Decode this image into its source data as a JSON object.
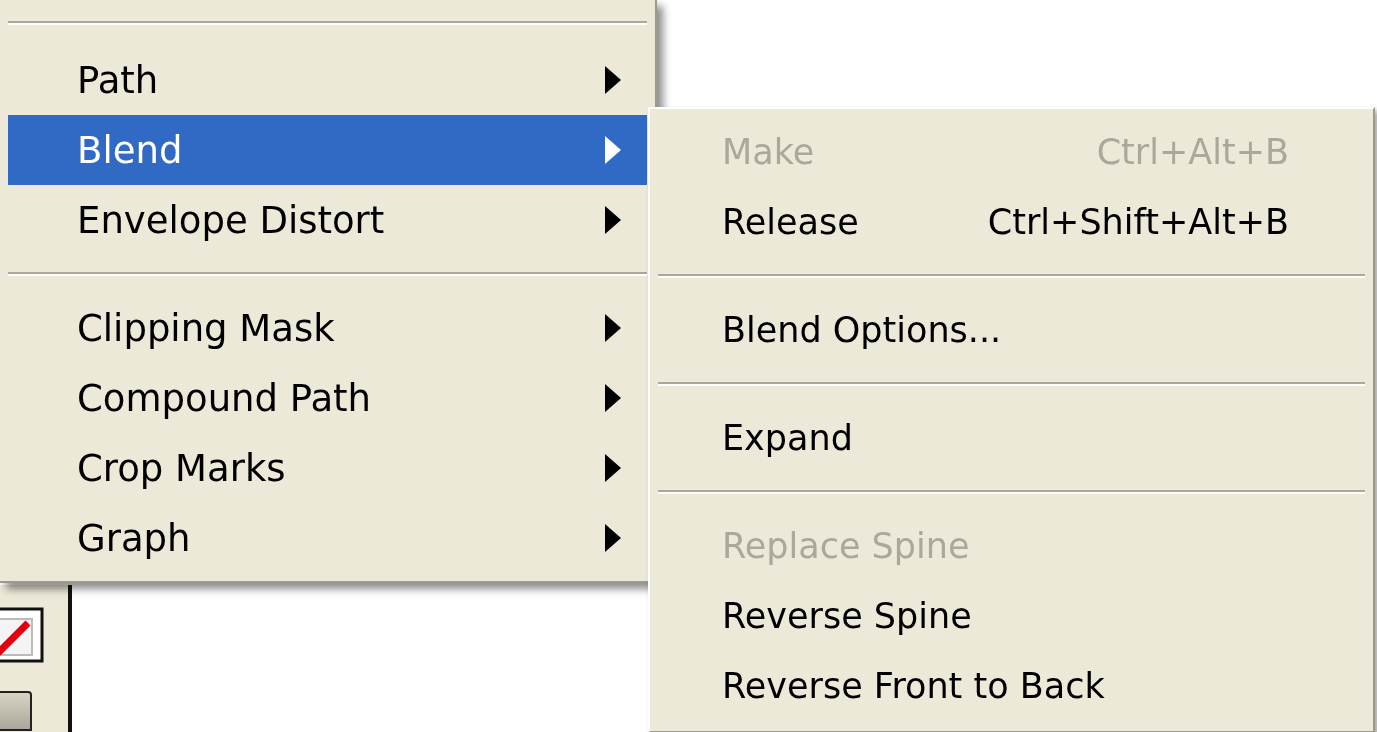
{
  "menu": {
    "items": [
      {
        "kind": "separator"
      },
      {
        "kind": "item",
        "label": "Path",
        "submenu": true,
        "selected": false
      },
      {
        "kind": "item",
        "label": "Blend",
        "submenu": true,
        "selected": true
      },
      {
        "kind": "item",
        "label": "Envelope Distort",
        "submenu": true,
        "selected": false
      },
      {
        "kind": "separator"
      },
      {
        "kind": "item",
        "label": "Clipping Mask",
        "submenu": true,
        "selected": false
      },
      {
        "kind": "item",
        "label": "Compound Path",
        "submenu": true,
        "selected": false
      },
      {
        "kind": "item",
        "label": "Crop Marks",
        "submenu": true,
        "selected": false
      },
      {
        "kind": "item",
        "label": "Graph",
        "submenu": true,
        "selected": false
      }
    ]
  },
  "submenu": {
    "items": [
      {
        "kind": "item",
        "label": "Make",
        "shortcut": "Ctrl+Alt+B",
        "disabled": true
      },
      {
        "kind": "item",
        "label": "Release",
        "shortcut": "Ctrl+Shift+Alt+B",
        "disabled": false
      },
      {
        "kind": "separator"
      },
      {
        "kind": "item",
        "label": "Blend Options...",
        "disabled": false
      },
      {
        "kind": "separator"
      },
      {
        "kind": "item",
        "label": "Expand",
        "disabled": false
      },
      {
        "kind": "separator"
      },
      {
        "kind": "item",
        "label": "Replace Spine",
        "disabled": true
      },
      {
        "kind": "item",
        "label": "Reverse Spine",
        "disabled": false
      },
      {
        "kind": "item",
        "label": "Reverse Front to Back",
        "disabled": false
      }
    ]
  }
}
